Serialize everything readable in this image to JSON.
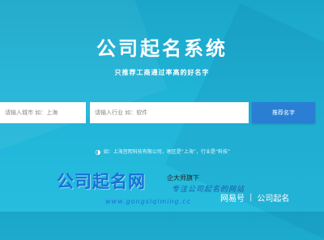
{
  "header": {
    "title": "公司起名系统",
    "subtitle": "只推荐工商通过率高的好名字"
  },
  "search": {
    "city_placeholder": "请输入城市 如：上海",
    "industry_placeholder": "请输入行业 如：软件",
    "submit_label": "推荐名字"
  },
  "example": {
    "icon": "lightbulb-icon",
    "text": "如：上海宫熙科技有限公司，地区是“上海”，行业是“科技”"
  },
  "brand": {
    "logo_text": "公司起名网",
    "tagline_top": "企大师旗下",
    "tagline_bottom": "专注公司起名的网站",
    "url": "www.gongsiqiming.cc"
  },
  "watermark": {
    "source": "网易号",
    "separator": "|",
    "account": "公司起名"
  },
  "colors": {
    "background": "#1fb3d6",
    "button": "#2a7fd4",
    "brand": "#1a6fd8"
  }
}
